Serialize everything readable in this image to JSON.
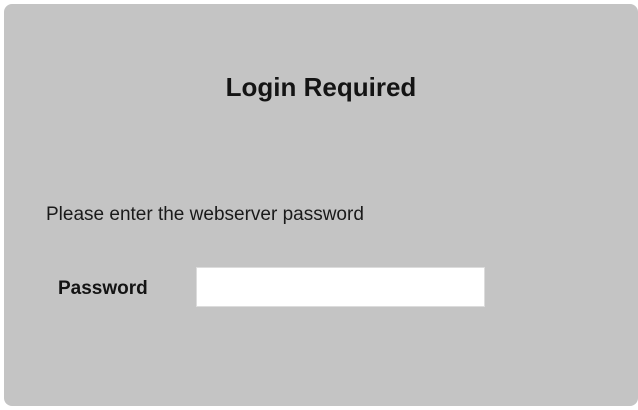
{
  "login": {
    "title": "Login Required",
    "instructions": "Please enter the webserver password",
    "password_label": "Password",
    "password_value": "",
    "password_placeholder": ""
  },
  "colors": {
    "panel_background": "#c4c4c4",
    "page_background": "#ffffff",
    "text": "#141414",
    "input_background": "#ffffff"
  }
}
